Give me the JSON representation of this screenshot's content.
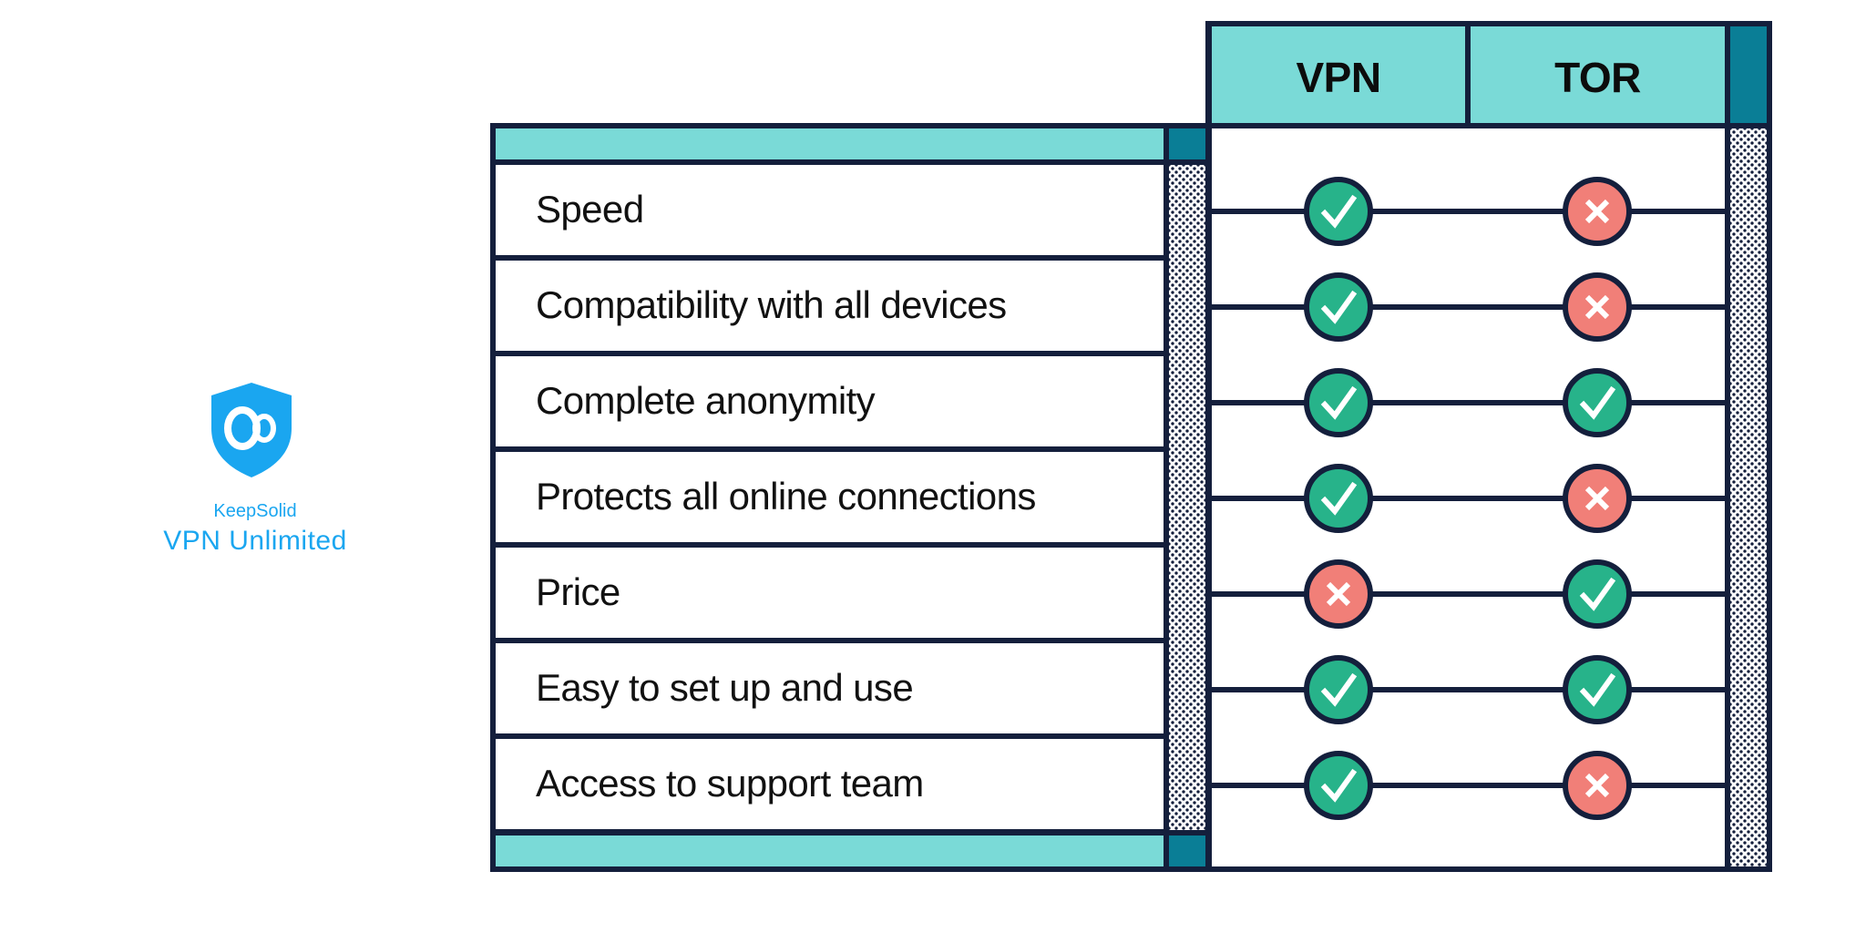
{
  "brand": {
    "company": "KeepSolid",
    "product": "VPN Unlimited",
    "logo_icon": "shield-infinity-icon",
    "color": "#1aa6f0"
  },
  "comparison": {
    "columns": [
      "VPN",
      "TOR"
    ],
    "features": [
      {
        "label": "Speed",
        "vpn": true,
        "tor": false
      },
      {
        "label": "Compatibility with all devices",
        "vpn": true,
        "tor": false
      },
      {
        "label": "Complete anonymity",
        "vpn": true,
        "tor": true
      },
      {
        "label": "Protects all online connections",
        "vpn": true,
        "tor": false
      },
      {
        "label": "Price",
        "vpn": false,
        "tor": true
      },
      {
        "label": "Easy to set up and use",
        "vpn": true,
        "tor": true
      },
      {
        "label": "Access to support team",
        "vpn": true,
        "tor": false
      }
    ],
    "icons": {
      "yes": "check-icon",
      "no": "cross-icon"
    },
    "colors": {
      "yes": "#27b38a",
      "no": "#f17f78",
      "header": "#7adad7",
      "accent": "#0a7e96",
      "border": "#141f3c"
    }
  }
}
